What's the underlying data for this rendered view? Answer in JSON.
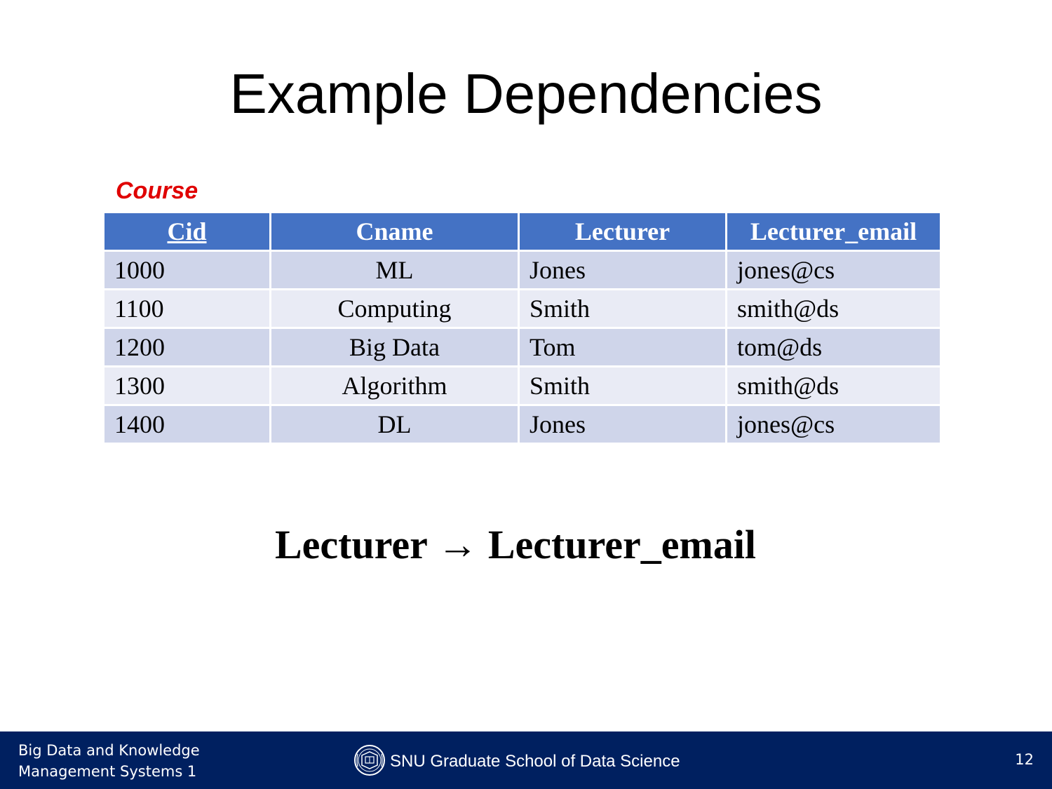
{
  "slide": {
    "title": "Example Dependencies",
    "table_caption": "Course",
    "dependency": "Lecturer → Lecturer_email"
  },
  "table": {
    "headers": [
      "Cid",
      "Cname",
      "Lecturer",
      "Lecturer_email"
    ],
    "rows": [
      [
        "1000",
        "ML",
        "Jones",
        "jones@cs"
      ],
      [
        "1100",
        "Computing",
        "Smith",
        "smith@ds"
      ],
      [
        "1200",
        "Big Data",
        "Tom",
        "tom@ds"
      ],
      [
        "1300",
        "Algorithm",
        "Smith",
        "smith@ds"
      ],
      [
        "1400",
        "DL",
        "Jones",
        "jones@cs"
      ]
    ]
  },
  "footer": {
    "course_line1": "Big Data and Knowledge",
    "course_line2": "Management Systems 1",
    "organization": "SNU Graduate School of Data Science",
    "page_number": "12"
  },
  "colors": {
    "header_blue": "#4472c4",
    "row_dark": "#cfd5ea",
    "row_light": "#e9ebf5",
    "caption_red": "#e00000",
    "footer_navy": "#002060"
  },
  "icons": {
    "footer_logo": "snu-emblem-icon"
  }
}
